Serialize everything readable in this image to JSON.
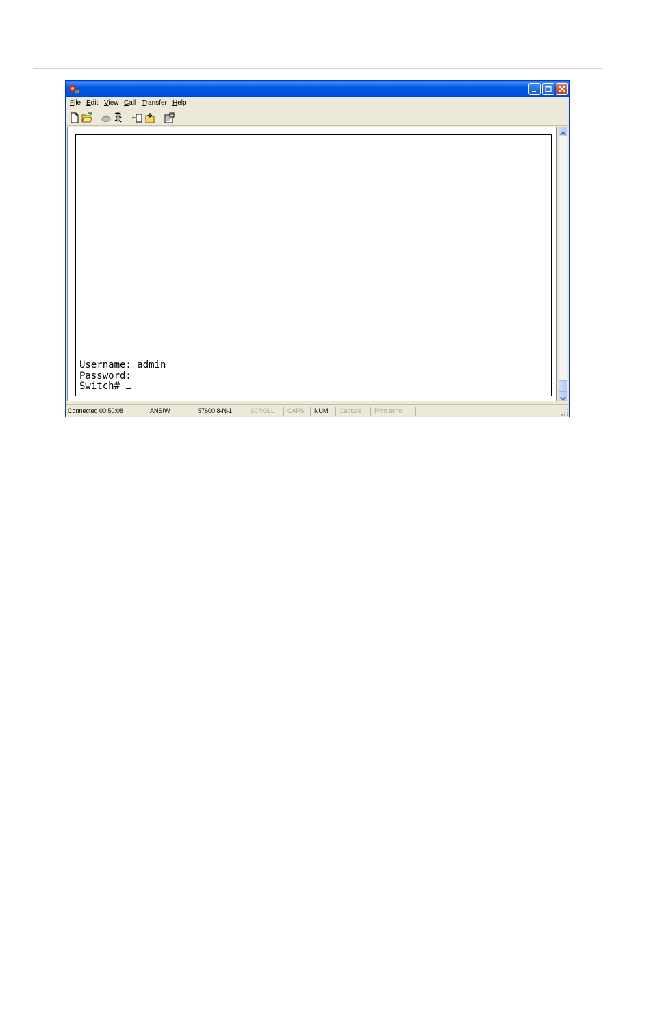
{
  "window": {
    "title": "",
    "colors": {
      "titlebar": "#0058e6",
      "chrome": "#ece9d8",
      "close_button": "#c43c19"
    },
    "icon": "hyperterminal-app-icon"
  },
  "menu": {
    "items": [
      {
        "accel": "F",
        "rest": "ile"
      },
      {
        "accel": "E",
        "rest": "dit"
      },
      {
        "accel": "V",
        "rest": "iew"
      },
      {
        "accel": "C",
        "rest": "all"
      },
      {
        "accel": "T",
        "rest": "ransfer"
      },
      {
        "accel": "H",
        "rest": "elp"
      }
    ]
  },
  "toolbar": {
    "buttons": [
      "new-connection-icon",
      "open-icon",
      "connect-icon",
      "disconnect-icon",
      "send-icon",
      "receive-icon",
      "properties-icon"
    ]
  },
  "terminal": {
    "lines": [
      "Username: admin",
      "Password:",
      "Switch# "
    ]
  },
  "status": {
    "connection": "Connected 00:50:08",
    "emulation": "ANSIW",
    "port_settings": "57600 8-N-1",
    "scroll": "SCROLL",
    "caps": "CAPS",
    "num": "NUM",
    "capture": "Capture",
    "print_echo": "Print echo"
  }
}
